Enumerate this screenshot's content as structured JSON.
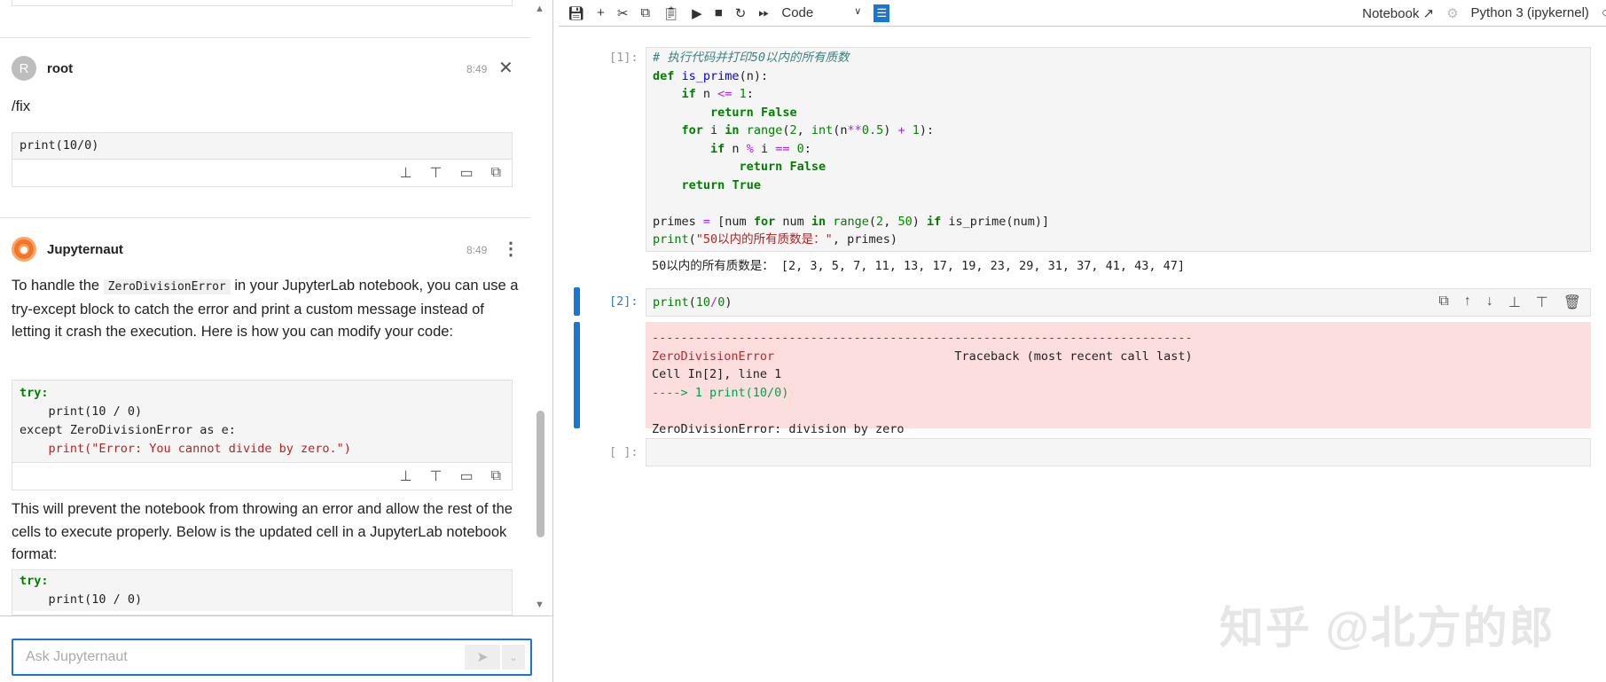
{
  "chat": {
    "messages": [
      {
        "author": "root",
        "avatar_letter": "R",
        "time": "8:49",
        "text": "/fix",
        "code": "print(10/0)"
      },
      {
        "author": "Jupyternaut",
        "time": "8:49",
        "para1_before": "To handle the ",
        "para1_code": "ZeroDivisionError",
        "para1_after": " in your JupyterLab notebook, you can use a try-except block to catch the error and print a custom message instead of letting it crash the execution. Here is how you can modify your code:",
        "code1": [
          "try:",
          "    print(10 / 0)",
          "except ZeroDivisionError as e:",
          "    print(\"Error: You cannot divide by zero.\")"
        ],
        "para2": "This will prevent the notebook from throwing an error and allow the rest of the cells to execute properly. Below is the updated cell in a JupyterLab notebook format:",
        "code2": [
          "try:",
          "    print(10 / 0)"
        ]
      }
    ],
    "input_placeholder": "Ask Jupyternaut"
  },
  "toolbar": {
    "cell_type": "Code",
    "notebook_label": "Notebook",
    "kernel": "Python 3 (ipykernel)"
  },
  "cells": [
    {
      "prompt": "[1]:",
      "output": "50以内的所有质数是： [2, 3, 5, 7, 11, 13, 17, 19, 23, 29, 31, 37, 41, 43, 47]"
    },
    {
      "prompt": "[2]:",
      "code": "print(10/0)",
      "error": {
        "dashes": "---------------------------------------------------------------------------",
        "name": "ZeroDivisionError",
        "traceback": "Traceback (most recent call last)",
        "cell_line": "Cell In[2], line 1",
        "arrow": "----> 1 print(10/0)",
        "message": "ZeroDivisionError: division by zero"
      }
    },
    {
      "prompt": "[ ]:"
    }
  ],
  "watermark": "知乎 @北方的郎",
  "colors": {
    "accent": "#1976d2",
    "error_bg": "#fddede",
    "jupyternaut": "#f37626"
  }
}
